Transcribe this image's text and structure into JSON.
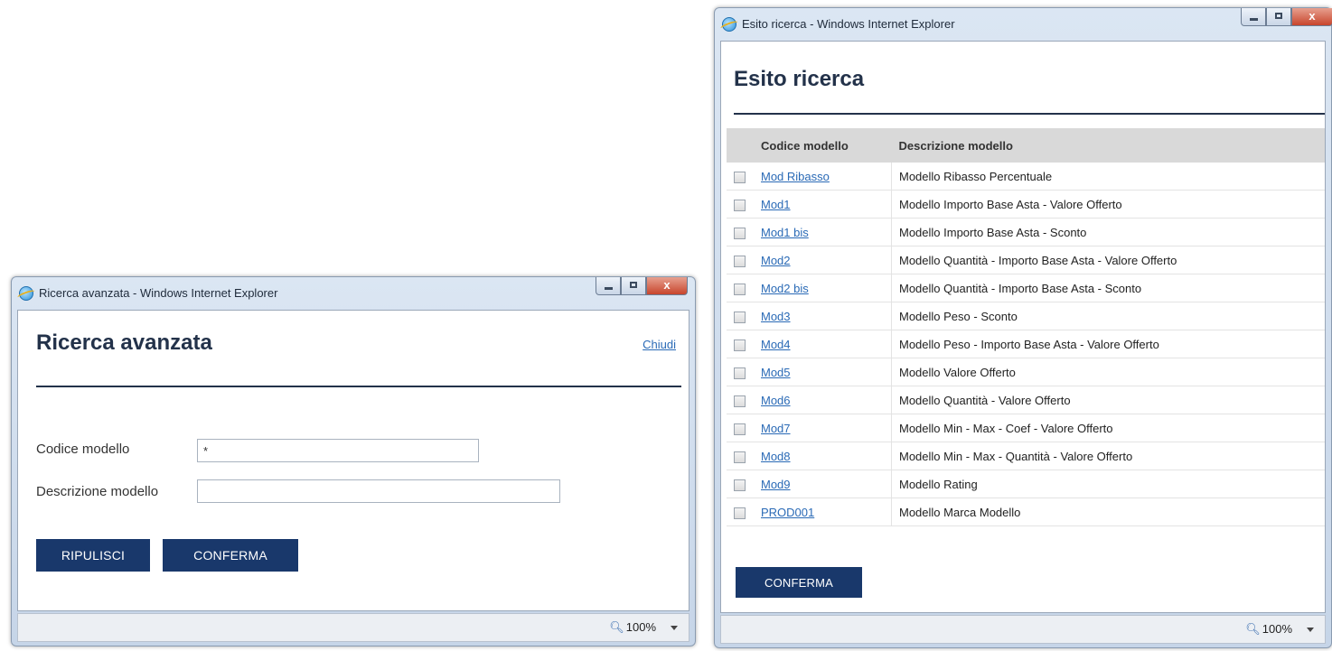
{
  "left_window": {
    "title": "Ricerca avanzata - Windows Internet Explorer",
    "close_glyph": "x",
    "heading": "Ricerca avanzata",
    "close_link": "Chiudi",
    "fields": {
      "codice_label": "Codice modello",
      "codice_value": "*",
      "descrizione_label": "Descrizione modello",
      "descrizione_value": ""
    },
    "buttons": {
      "clear": "RIPULISCI",
      "confirm": "CONFERMA"
    },
    "status": {
      "zoom": "100%"
    }
  },
  "right_window": {
    "title": "Esito ricerca - Windows Internet Explorer",
    "close_glyph": "x",
    "heading": "Esito ricerca",
    "table": {
      "headers": [
        "Codice modello",
        "Descrizione modello"
      ],
      "rows": [
        {
          "code": "Mod Ribasso",
          "description": "Modello Ribasso Percentuale"
        },
        {
          "code": "Mod1",
          "description": "Modello Importo Base Asta - Valore Offerto"
        },
        {
          "code": "Mod1 bis",
          "description": "Modello Importo Base Asta - Sconto"
        },
        {
          "code": "Mod2",
          "description": "Modello Quantità - Importo Base Asta - Valore Offerto"
        },
        {
          "code": "Mod2 bis",
          "description": "Modello Quantità - Importo Base Asta - Sconto"
        },
        {
          "code": "Mod3",
          "description": "Modello Peso - Sconto"
        },
        {
          "code": "Mod4",
          "description": "Modello Peso - Importo Base Asta - Valore Offerto"
        },
        {
          "code": "Mod5",
          "description": "Modello Valore Offerto"
        },
        {
          "code": "Mod6",
          "description": "Modello Quantità - Valore Offerto"
        },
        {
          "code": "Mod7",
          "description": "Modello Min - Max - Coef - Valore Offerto"
        },
        {
          "code": "Mod8",
          "description": "Modello Min - Max - Quantità - Valore Offerto"
        },
        {
          "code": "Mod9",
          "description": "Modello Rating"
        },
        {
          "code": "PROD001",
          "description": "Modello Marca Modello"
        }
      ]
    },
    "buttons": {
      "confirm": "CONFERMA"
    },
    "status": {
      "zoom": "100%"
    }
  },
  "colors": {
    "primary_button": "#19386b",
    "heading": "#23324a",
    "link": "#2a6ab6",
    "table_header": "#d9d9d9"
  }
}
